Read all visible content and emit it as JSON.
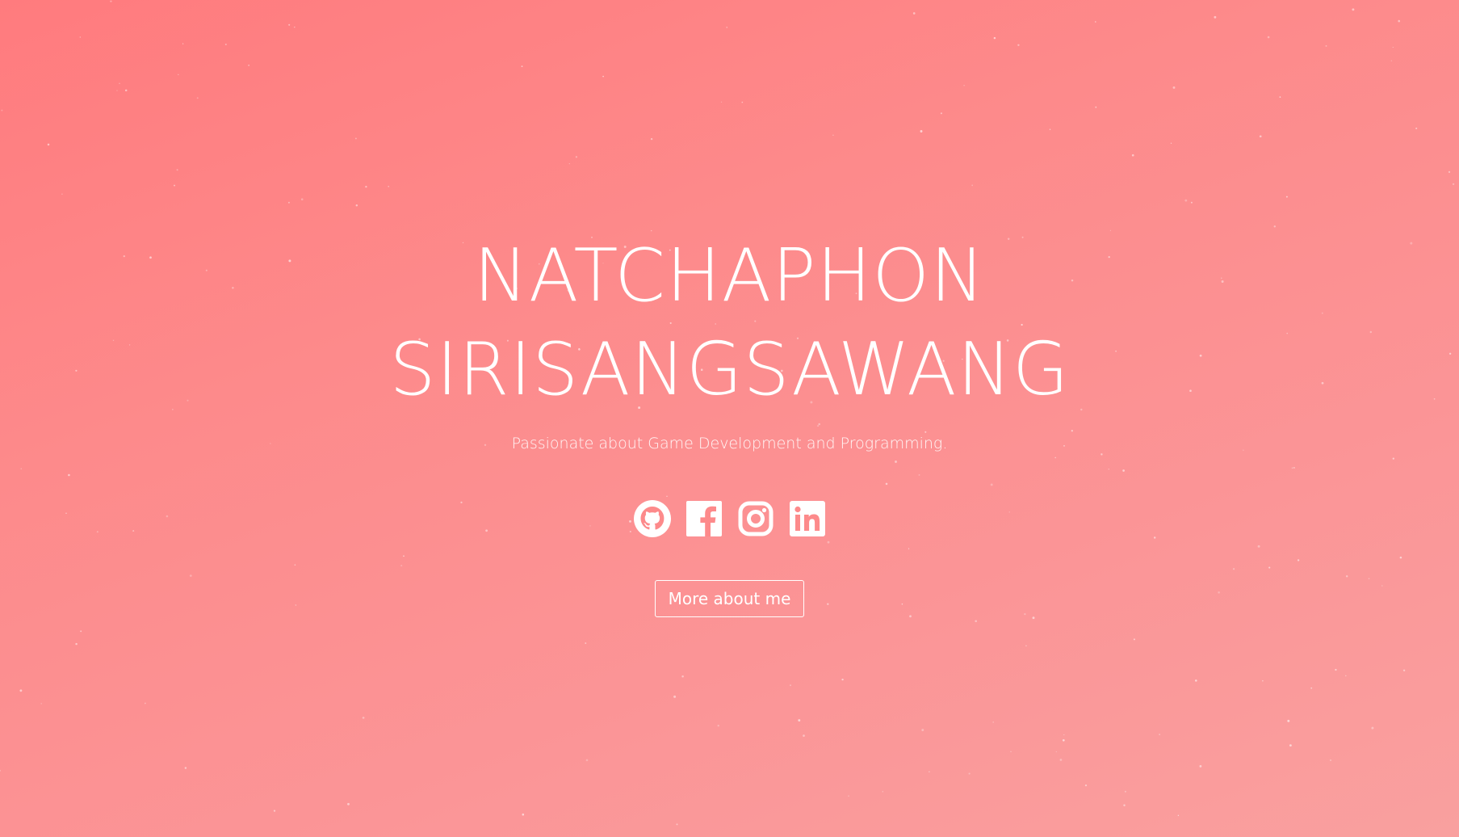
{
  "hero": {
    "name_line1": "NATCHAPHON",
    "name_line2": "SIRISANGSAWANG",
    "tagline": "Passionate about Game Development and Programming.",
    "cta_label": "More about me"
  },
  "socials": [
    {
      "icon": "github-icon"
    },
    {
      "icon": "facebook-icon"
    },
    {
      "icon": "instagram-icon"
    },
    {
      "icon": "linkedin-icon"
    }
  ],
  "colors": {
    "background_start": "#ff7b7e",
    "background_end": "#f9a09f",
    "text": "#ffffff"
  }
}
